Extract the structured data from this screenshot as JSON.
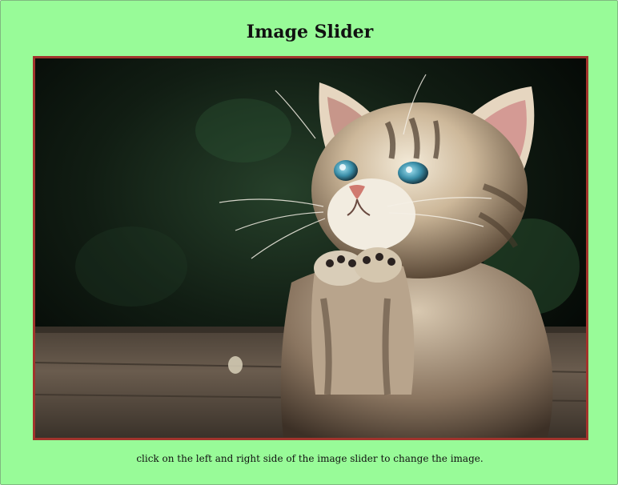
{
  "page": {
    "title": "Image Slider",
    "caption": "click on the left and right side of the image slider to change the image."
  },
  "slider": {
    "current_image": "kitten-praying-photo"
  },
  "colors": {
    "background": "#98fb98",
    "slider_border": "#a0342c",
    "text": "#111111"
  }
}
